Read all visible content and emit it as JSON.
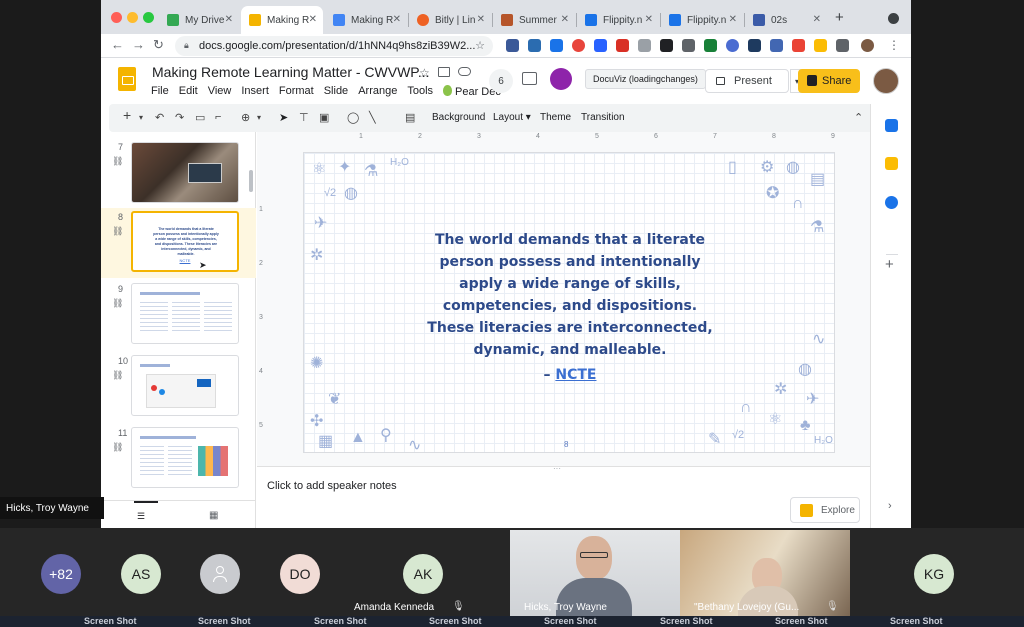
{
  "browser": {
    "tabs": [
      {
        "label": "My Drive",
        "color": "#34a853"
      },
      {
        "label": "Making R",
        "color": "#f4b400"
      },
      {
        "label": "Making R",
        "color": "#4285f4"
      },
      {
        "label": "Bitly | Lin",
        "color": "#ee6123"
      },
      {
        "label": "Summer",
        "color": "#b6552a"
      },
      {
        "label": "Flippity.n",
        "color": "#1a73e8"
      },
      {
        "label": "Flippity.n",
        "color": "#1a73e8"
      },
      {
        "label": "02s",
        "color": "#3b5ba8"
      }
    ],
    "new_tab": "+",
    "url": "docs.google.com/presentation/d/1hNN4q9hs8ziB39W2..."
  },
  "docs": {
    "title": "Making Remote Learning Matter - CWVWP...",
    "menus": [
      "File",
      "Edit",
      "View",
      "Insert",
      "Format",
      "Slide",
      "Arrange",
      "Tools",
      "Pear Dec"
    ],
    "viewer_count": "6",
    "docuviz_label": "DocuViz (loadingchanges)",
    "present_label": "Present",
    "share_label": "Share"
  },
  "edit_toolbar": {
    "background": "Background",
    "layout": "Layout",
    "theme": "Theme",
    "transition": "Transition"
  },
  "filmstrip": {
    "slides": [
      {
        "number": "7"
      },
      {
        "number": "8",
        "selected": true,
        "preview_text": "The world demands that a literate person possess and intentionally apply a wide range of skills, competencies, and dispositions. These literacies are interconnected, dynamic, and malleable.",
        "preview_link": "NCTE"
      },
      {
        "number": "9"
      },
      {
        "number": "10"
      },
      {
        "number": "11"
      }
    ]
  },
  "ruler": {
    "top": [
      "1",
      "2",
      "3",
      "4",
      "5",
      "6",
      "7",
      "8",
      "9"
    ],
    "left": [
      "1",
      "2",
      "3",
      "4",
      "5"
    ]
  },
  "slide": {
    "quote_lines": [
      "The world demands that a literate",
      "person possess and intentionally",
      "apply a wide range of skills,",
      "competencies, and dispositions.",
      "These literacies are interconnected,",
      "dynamic, and malleable."
    ],
    "attribution_dash": "–",
    "attribution_link": "NCTE",
    "page_number": "8",
    "doodle_formula_1": "H₂O",
    "doodle_formula_2": "√2",
    "doodle_formula_3": "H₂O"
  },
  "notes": {
    "placeholder": "Click to add speaker notes",
    "explore_label": "Explore"
  },
  "meeting": {
    "active_speaker": "Hicks, Troy Wayne",
    "participants": [
      {
        "initials": "+82",
        "bg": "#6264a7",
        "fg": "#ffffff"
      },
      {
        "initials": "AS",
        "bg": "#d7e8d1",
        "fg": "#333333"
      },
      {
        "initials": "",
        "bg": "#c9cbcf",
        "fg": "#333333"
      },
      {
        "initials": "DO",
        "bg": "#f1dcd6",
        "fg": "#333333"
      },
      {
        "initials": "AK",
        "bg": "#d7e8d1",
        "fg": "#333333",
        "name": "Amanda Kenneda"
      },
      {
        "initials": "KG",
        "bg": "#d7e8d1",
        "fg": "#333333"
      }
    ],
    "video_names": [
      "Hicks, Troy Wayne",
      "\"Bethany Lovejoy (Gu..."
    ],
    "screenshot_label": "Screen Shot"
  }
}
